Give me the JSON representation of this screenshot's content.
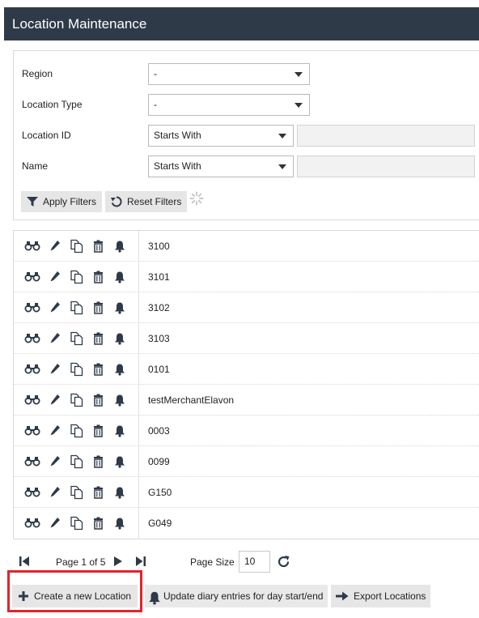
{
  "header": {
    "title": "Location Maintenance"
  },
  "filters": {
    "region": {
      "label": "Region",
      "value": "-"
    },
    "location_type": {
      "label": "Location Type",
      "value": "-"
    },
    "location_id": {
      "label": "Location ID",
      "match": "Starts With",
      "value": ""
    },
    "name": {
      "label": "Name",
      "match": "Starts With",
      "value": ""
    },
    "apply_label": "Apply Filters",
    "reset_label": "Reset Filters"
  },
  "rows": [
    {
      "value": "3100"
    },
    {
      "value": "3101"
    },
    {
      "value": "3102"
    },
    {
      "value": "3103"
    },
    {
      "value": "0101"
    },
    {
      "value": "testMerchantElavon"
    },
    {
      "value": "0003"
    },
    {
      "value": "0099"
    },
    {
      "value": "G150"
    },
    {
      "value": "G049"
    }
  ],
  "row_actions": [
    "binoculars-icon",
    "pencil-icon",
    "copy-icon",
    "trash-icon",
    "bell-icon"
  ],
  "pager": {
    "page_label": "Page 1 of 5",
    "page_size_label": "Page Size",
    "page_size": "10"
  },
  "footer": {
    "create_label": "Create a new Location",
    "diary_label": "Update diary entries for day start/end",
    "export_label": "Export Locations"
  },
  "colors": {
    "header_bg": "#2f3a48",
    "icon": "#2f3a48",
    "highlight": "#e0252b",
    "button_bg": "#e6e6e6"
  }
}
